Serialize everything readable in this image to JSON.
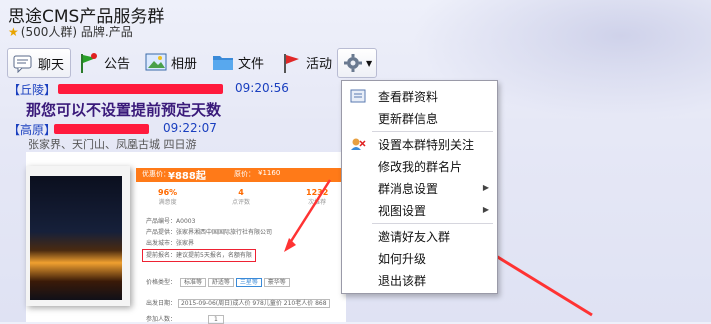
{
  "header": {
    "title": "思途CMS产品服务群",
    "member_count": "(500人群)",
    "category": "品牌.产品"
  },
  "toolbar": {
    "chat": "聊天",
    "announce": "公告",
    "album": "相册",
    "files": "文件",
    "activity": "活动"
  },
  "messages": [
    {
      "sender": "【丘陵】",
      "time": "09:20:56",
      "text": "那您可以不设置提前预定天数"
    },
    {
      "sender": "【高原】",
      "time": "09:22:07"
    }
  ],
  "image": {
    "tour_title": "张家界、天门山、凤凰古城 四日游",
    "price_label": "优惠价：",
    "price": "¥888起",
    "orig_label": "原价：",
    "orig_price": "¥1160",
    "stats": [
      {
        "value": "96%",
        "label": "满意度"
      },
      {
        "value": "4",
        "label": "点评数"
      },
      {
        "value": "1232",
        "label": "次推荐"
      }
    ],
    "fields": [
      {
        "label": "产品编号：",
        "value": "A0003"
      },
      {
        "label": "产品提供：",
        "value": "张家界湘西中国国际旅行社有限公司"
      },
      {
        "label": "出发城市：",
        "value": "张家界"
      },
      {
        "label": "提前报名：",
        "value": "建议提前5天报名，名额有限"
      }
    ],
    "grade_label": "价格类型：",
    "grades": [
      "标准等",
      "舒适等",
      "三星等",
      "豪华等"
    ],
    "date_label": "出发日期：",
    "date_value": "2015-09-06(周日)成人价 978儿童价 210老人价 868",
    "qty_label": "参加人数：",
    "qty_value": "1"
  },
  "context_menu": {
    "items": [
      {
        "label": "查看群资料",
        "submenu": false
      },
      {
        "label": "更新群信息",
        "submenu": false
      },
      {
        "label": "设置本群特别关注",
        "submenu": false
      },
      {
        "label": "修改我的群名片",
        "submenu": false
      },
      {
        "label": "群消息设置",
        "submenu": true
      },
      {
        "label": "视图设置",
        "submenu": true
      },
      {
        "label": "邀请好友入群",
        "submenu": false
      },
      {
        "label": "如何升级",
        "submenu": false
      },
      {
        "label": "退出该群",
        "submenu": false
      }
    ]
  },
  "colors": {
    "accent": "#ff3333",
    "link": "#1a3fbf",
    "price": "#ff6a00"
  }
}
